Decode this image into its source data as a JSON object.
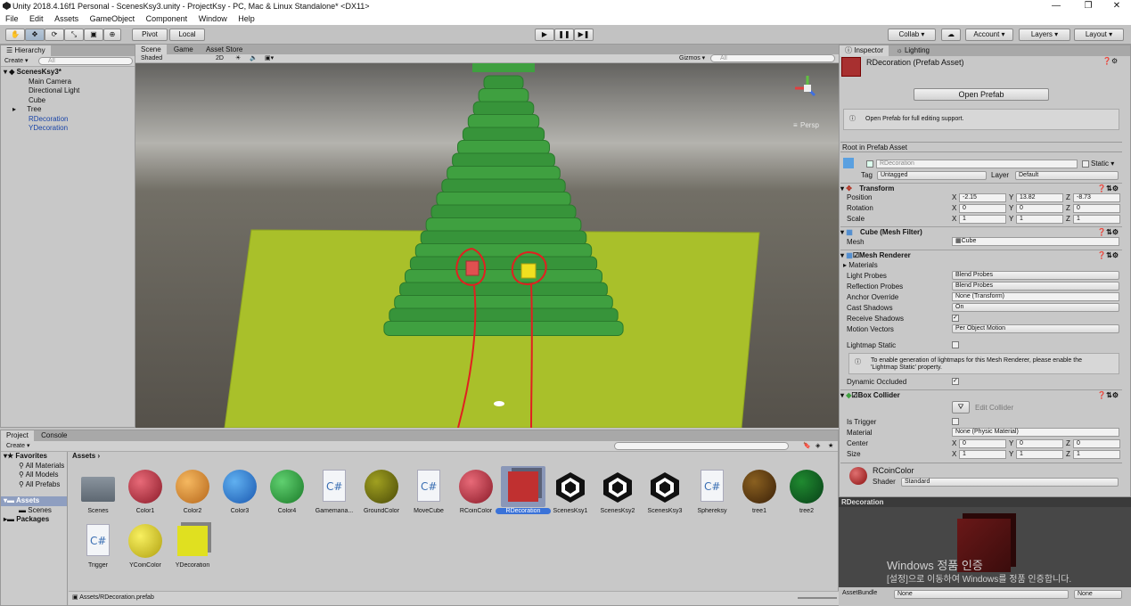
{
  "window": {
    "title": "Unity 2018.4.16f1 Personal - ScenesKsy3.unity - ProjectKsy - PC, Mac & Linux Standalone* <DX11>",
    "minimize": "—",
    "maximize": "❐",
    "close": "✕"
  },
  "menu": [
    "File",
    "Edit",
    "Assets",
    "GameObject",
    "Component",
    "Window",
    "Help"
  ],
  "toolbar": {
    "pivot": "Pivot",
    "local": "Local",
    "collab": "Collab ▾",
    "account": "Account",
    "layers": "Layers",
    "layout": "Layout"
  },
  "hierarchy": {
    "tab": "Hierarchy",
    "create": "Create ▾",
    "search_placeholder": "All",
    "scene": "ScenesKsy3*",
    "items": [
      "Main Camera",
      "Directional Light",
      "Cube",
      "Tree",
      "RDecoration",
      "YDecoration"
    ]
  },
  "scene_view": {
    "tabs": [
      "Scene",
      "Game",
      "Asset Store"
    ],
    "shading": "Shaded",
    "mode2d": "2D",
    "gizmos": "Gizmos ▾",
    "search_placeholder": "All",
    "persp": "Persp"
  },
  "project": {
    "tabs": [
      "Project",
      "Console"
    ],
    "create": "Create ▾",
    "favorites": "Favorites",
    "fav_items": [
      "All Materials",
      "All Models",
      "All Prefabs"
    ],
    "assets_root": "Assets",
    "assets_children": [
      "Scenes"
    ],
    "packages": "Packages",
    "breadcrumb": "Assets",
    "status_path": "Assets/RDecoration.prefab",
    "assets": [
      "Scenes",
      "Color1",
      "Color2",
      "Color3",
      "Color4",
      "Gamemana...",
      "GroundColor",
      "MoveCube",
      "RCoinColor",
      "RDecoration",
      "ScenesKsy1",
      "ScenesKsy2",
      "ScenesKsy3",
      "Sphereksy",
      "tree1",
      "tree2",
      "Trigger",
      "YCoinColor",
      "YDecoration"
    ]
  },
  "inspector": {
    "tabs": [
      "Inspector",
      "Lighting"
    ],
    "asset_title": "RDecoration (Prefab Asset)",
    "open_prefab": "Open Prefab",
    "open_info": "Open Prefab for full editing support.",
    "root_label": "Root in Prefab Asset",
    "name": "RDecoration",
    "static": "Static",
    "tag_label": "Tag",
    "tag": "Untagged",
    "layer_label": "Layer",
    "layer": "Default",
    "transform": {
      "title": "Transform",
      "position_label": "Position",
      "rotation_label": "Rotation",
      "scale_label": "Scale",
      "position": [
        "-2.15",
        "13.82",
        "-8.73"
      ],
      "rotation": [
        "0",
        "0",
        "0"
      ],
      "scale": [
        "1",
        "1",
        "1"
      ]
    },
    "mesh_filter": {
      "title": "Cube (Mesh Filter)",
      "mesh_label": "Mesh",
      "mesh": "Cube"
    },
    "mesh_renderer": {
      "title": "Mesh Renderer",
      "materials": "Materials",
      "light_probes_label": "Light Probes",
      "light_probes": "Blend Probes",
      "reflection_probes_label": "Reflection Probes",
      "reflection_probes": "Blend Probes",
      "anchor_label": "Anchor Override",
      "anchor": "None (Transform)",
      "cast_shadows_label": "Cast Shadows",
      "cast_shadows": "On",
      "receive_shadows_label": "Receive Shadows",
      "motion_vectors_label": "Motion Vectors",
      "motion_vectors": "Per Object Motion",
      "lightmap_static_label": "Lightmap Static",
      "lightmap_info_1": "To enable generation of lightmaps for this Mesh Renderer, please enable the",
      "lightmap_info_2": "'Lightmap Static' property.",
      "dynamic_occluded_label": "Dynamic Occluded"
    },
    "box_collider": {
      "title": "Box Collider",
      "edit_collider": "Edit Collider",
      "is_trigger_label": "Is Trigger",
      "material_label": "Material",
      "material": "None (Physic Material)",
      "center_label": "Center",
      "center": [
        "0",
        "0",
        "0"
      ],
      "size_label": "Size",
      "size": [
        "1",
        "1",
        "1"
      ]
    },
    "material": {
      "name": "RCoinColor",
      "shader_label": "Shader",
      "shader": "Standard"
    },
    "preview": {
      "title": "RDecoration",
      "watermark_1": "Windows 정품 인증",
      "watermark_2": "[설정]으로 이동하여 Windows를 정품 인증합니다.",
      "assetbundle_label": "AssetBundle",
      "assetbundle": "None",
      "variant": "None"
    }
  },
  "colors": {
    "tree_green": "#3a9a3a",
    "ground": "#a9c02a",
    "red_cube": "#e05050",
    "yellow_cube": "#f0e020",
    "annotation": "#e02020"
  }
}
